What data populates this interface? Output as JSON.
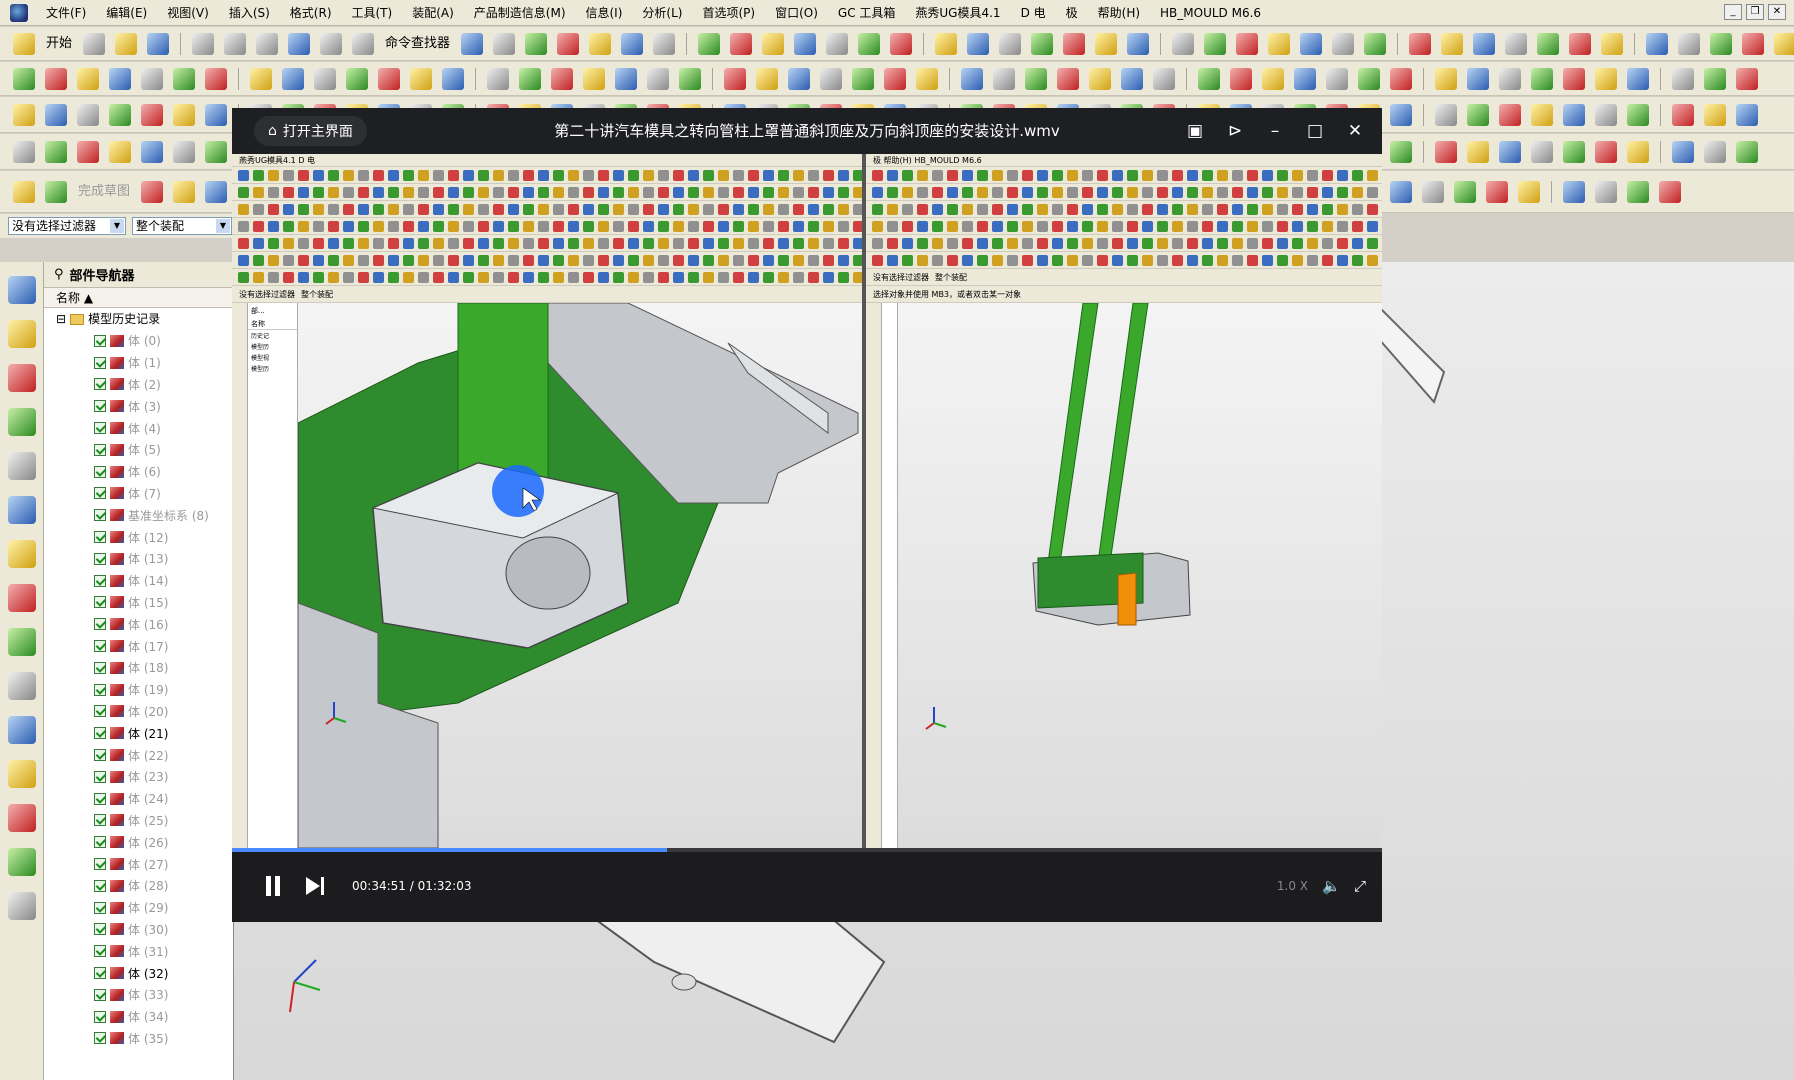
{
  "menubar": {
    "items": [
      "文件(F)",
      "编辑(E)",
      "视图(V)",
      "插入(S)",
      "格式(R)",
      "工具(T)",
      "装配(A)",
      "产品制造信息(M)",
      "信息(I)",
      "分析(L)",
      "首选项(P)",
      "窗口(O)",
      "GC 工具箱",
      "燕秀UG模具4.1",
      "D 电",
      "极",
      "帮助(H)",
      "HB_MOULD M6.6"
    ]
  },
  "toolbar": {
    "start_label": "开始",
    "command_finder_label": "命令查找器",
    "finish_sketch_label": "完成草图"
  },
  "filter": {
    "selection_filter": "没有选择过滤器",
    "scope": "整个装配"
  },
  "part_navigator": {
    "title": "部件导航器",
    "column_name": "名称",
    "root": "模型历史记录",
    "rows": [
      {
        "label": "体 (0)",
        "active": false
      },
      {
        "label": "体 (1)",
        "active": false
      },
      {
        "label": "体 (2)",
        "active": false
      },
      {
        "label": "体 (3)",
        "active": false
      },
      {
        "label": "体 (4)",
        "active": false
      },
      {
        "label": "体 (5)",
        "active": false
      },
      {
        "label": "体 (6)",
        "active": false
      },
      {
        "label": "体 (7)",
        "active": false
      },
      {
        "label": "基准坐标系 (8)",
        "active": false
      },
      {
        "label": "体 (12)",
        "active": false
      },
      {
        "label": "体 (13)",
        "active": false
      },
      {
        "label": "体 (14)",
        "active": false
      },
      {
        "label": "体 (15)",
        "active": false
      },
      {
        "label": "体 (16)",
        "active": false
      },
      {
        "label": "体 (17)",
        "active": false
      },
      {
        "label": "体 (18)",
        "active": false
      },
      {
        "label": "体 (19)",
        "active": false
      },
      {
        "label": "体 (20)",
        "active": false
      },
      {
        "label": "体 (21)",
        "active": true
      },
      {
        "label": "体 (22)",
        "active": false
      },
      {
        "label": "体 (23)",
        "active": false
      },
      {
        "label": "体 (24)",
        "active": false
      },
      {
        "label": "体 (25)",
        "active": false
      },
      {
        "label": "体 (26)",
        "active": false
      },
      {
        "label": "体 (27)",
        "active": false
      },
      {
        "label": "体 (28)",
        "active": false
      },
      {
        "label": "体 (29)",
        "active": false
      },
      {
        "label": "体 (30)",
        "active": false
      },
      {
        "label": "体 (31)",
        "active": false
      },
      {
        "label": "体 (32)",
        "active": true
      },
      {
        "label": "体 (33)",
        "active": false
      },
      {
        "label": "体 (34)",
        "active": false
      },
      {
        "label": "体 (35)",
        "active": false
      }
    ]
  },
  "player": {
    "home_label": "打开主界面",
    "title": "第二十讲汽车模具之转向管柱上罩普通斜顶座及万向斜顶座的安装设计.wmv",
    "current_time": "00:34:51",
    "total_time": "01:32:03",
    "progress": 0.3786,
    "speed": "1.0 X"
  },
  "video": {
    "left_window_title": "燕秀UG模具4.1 D 电",
    "right_window_title": "极 帮助(H) HB_MOULD M6.6",
    "left_filter": "没有选择过滤器",
    "left_scope": "整个装配",
    "right_filter": "没有选择过滤器",
    "right_scope": "整个装配",
    "right_status": "选择对象并使用 MB3，或者双击某一对象",
    "nav_label": "部...",
    "nav_column": "名称",
    "nav_items": [
      "历史记",
      "模型历",
      "模型视",
      "模型历"
    ]
  },
  "colors": {
    "model_green": "#2e8b2e",
    "rod_green": "#3aa82a",
    "model_gray": "#c4c8cc",
    "accent_orange": "#f0900a",
    "cursor_blue": "#1a6aff"
  }
}
